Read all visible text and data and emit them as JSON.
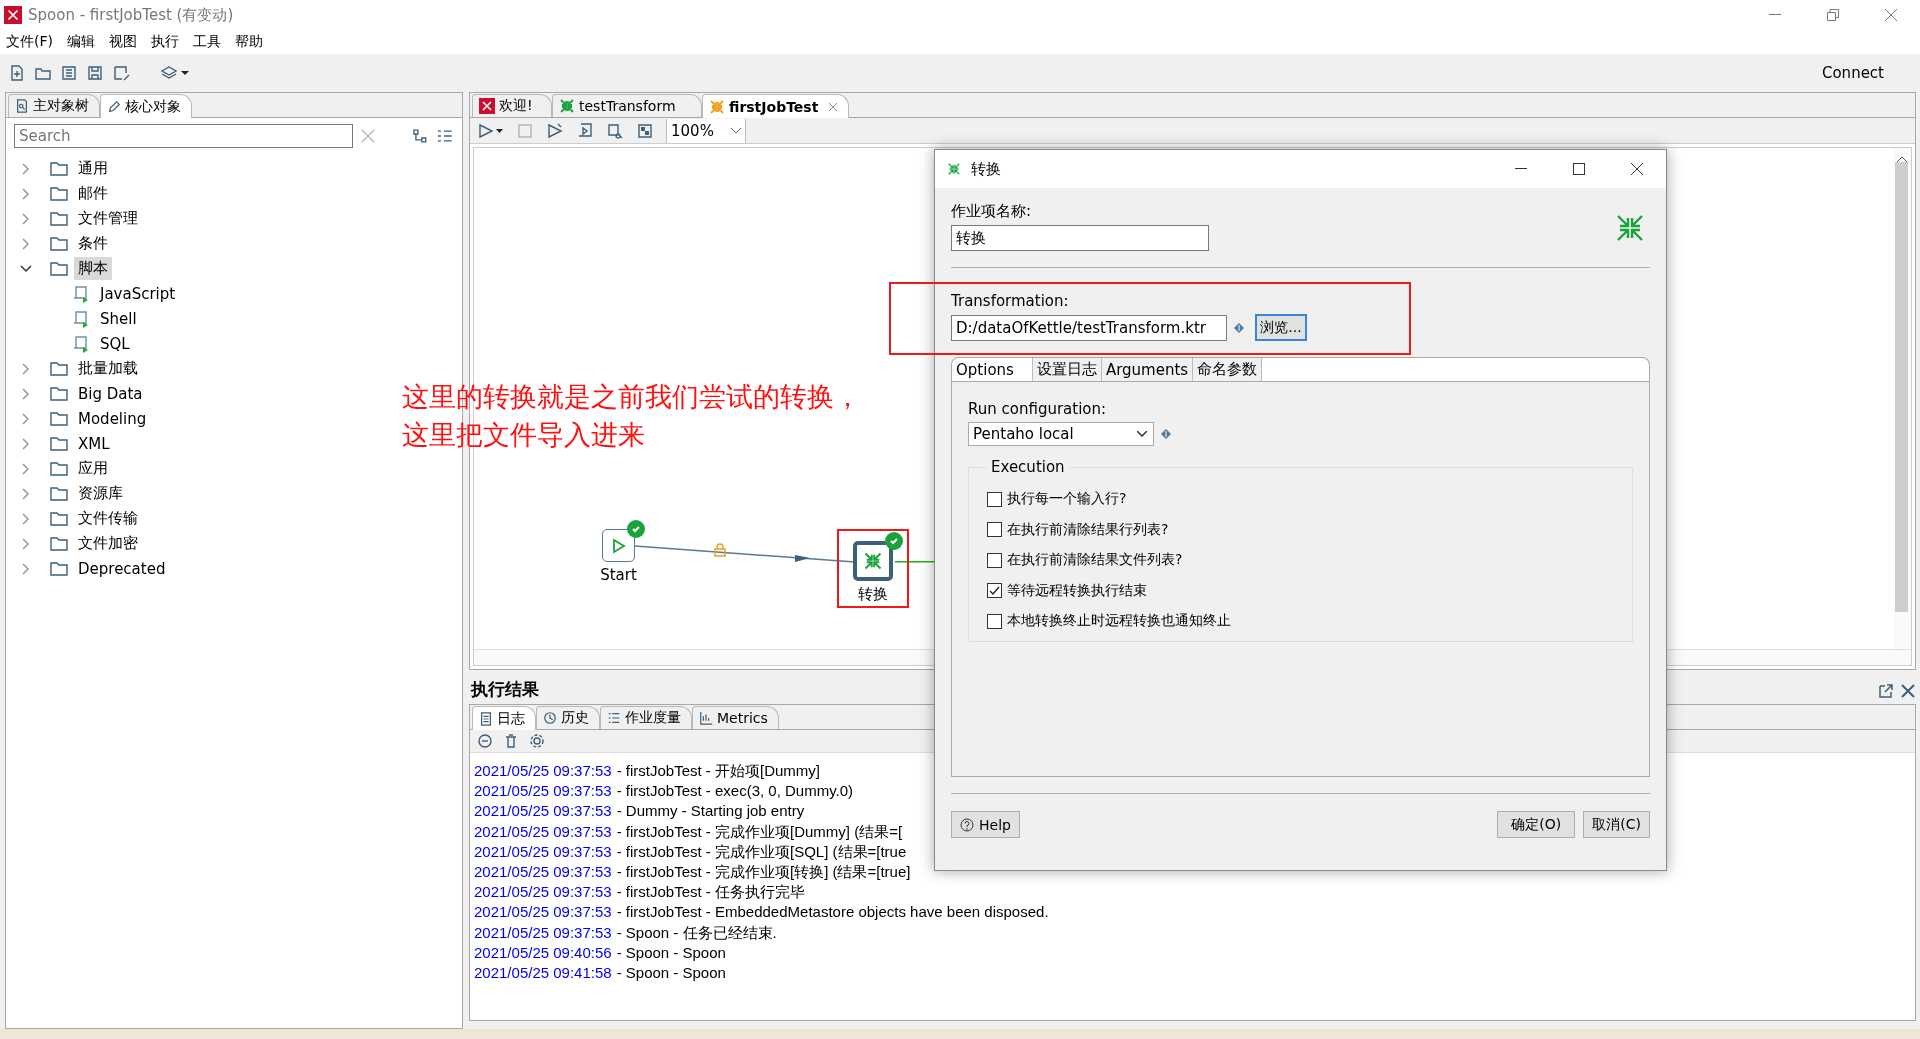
{
  "window": {
    "title": "Spoon - firstJobTest (有变动)"
  },
  "menu": [
    "文件(F)",
    "编辑",
    "视图",
    "执行",
    "工具",
    "帮助"
  ],
  "toolbar": {
    "connect": "Connect"
  },
  "left_panel": {
    "tabs": [
      {
        "label": "主对象树",
        "selected": false
      },
      {
        "label": "核心对象",
        "selected": true
      }
    ],
    "search": {
      "placeholder": "Search"
    },
    "tree": [
      {
        "label": "通用",
        "expanded": false,
        "selected": false
      },
      {
        "label": "邮件",
        "expanded": false,
        "selected": false
      },
      {
        "label": "文件管理",
        "expanded": false,
        "selected": false
      },
      {
        "label": "条件",
        "expanded": false,
        "selected": false
      },
      {
        "label": "脚本",
        "expanded": true,
        "selected": true,
        "children": [
          {
            "label": "JavaScript"
          },
          {
            "label": "Shell"
          },
          {
            "label": "SQL"
          }
        ]
      },
      {
        "label": "批量加载",
        "expanded": false,
        "selected": false
      },
      {
        "label": "Big Data",
        "expanded": false,
        "selected": false
      },
      {
        "label": "Modeling",
        "expanded": false,
        "selected": false
      },
      {
        "label": "XML",
        "expanded": false,
        "selected": false
      },
      {
        "label": "应用",
        "expanded": false,
        "selected": false
      },
      {
        "label": "资源库",
        "expanded": false,
        "selected": false
      },
      {
        "label": "文件传输",
        "expanded": false,
        "selected": false
      },
      {
        "label": "文件加密",
        "expanded": false,
        "selected": false
      },
      {
        "label": "Deprecated",
        "expanded": false,
        "selected": false
      }
    ]
  },
  "editor": {
    "tabs": [
      {
        "label": "欢迎!",
        "kind": "welcome",
        "selected": false
      },
      {
        "label": "testTransform",
        "kind": "transform",
        "selected": false
      },
      {
        "label": "firstJobTest",
        "kind": "job",
        "selected": true
      }
    ],
    "zoom": "100%",
    "annotation": [
      "这里的转换就是之前我们尝试的转换，",
      "这里把文件导入进来"
    ],
    "nodes": [
      {
        "label": "Start",
        "kind": "start",
        "done": true,
        "highlighted": false
      },
      {
        "label": "转换",
        "kind": "transform",
        "done": true,
        "highlighted": true
      }
    ]
  },
  "results": {
    "title": "执行结果",
    "tabs": [
      {
        "label": "日志",
        "selected": true
      },
      {
        "label": "历史",
        "selected": false
      },
      {
        "label": "作业度量",
        "selected": false
      },
      {
        "label": "Metrics",
        "selected": false
      }
    ],
    "log": [
      {
        "time": "2021/05/25 09:37:53",
        "message": "- firstJobTest - 开始项[Dummy]"
      },
      {
        "time": "2021/05/25 09:37:53",
        "message": "- firstJobTest - exec(3, 0, Dummy.0)"
      },
      {
        "time": "2021/05/25 09:37:53",
        "message": "- Dummy - Starting job entry"
      },
      {
        "time": "2021/05/25 09:37:53",
        "message": "- firstJobTest - 完成作业项[Dummy] (结果=["
      },
      {
        "time": "2021/05/25 09:37:53",
        "message": "- firstJobTest - 完成作业项[SQL] (结果=[true"
      },
      {
        "time": "2021/05/25 09:37:53",
        "message": "- firstJobTest - 完成作业项[转换] (结果=[true]"
      },
      {
        "time": "2021/05/25 09:37:53",
        "message": "- firstJobTest - 任务执行完毕"
      },
      {
        "time": "2021/05/25 09:37:53",
        "message": "- firstJobTest - EmbeddedMetastore objects have been disposed."
      },
      {
        "time": "2021/05/25 09:37:53",
        "message": "- Spoon - 任务已经结束."
      },
      {
        "time": "2021/05/25 09:40:56",
        "message": "- Spoon - Spoon"
      },
      {
        "time": "2021/05/25 09:41:58",
        "message": "- Spoon - Spoon"
      }
    ]
  },
  "dialog": {
    "title": "转换",
    "name_label": "作业项名称:",
    "name_value": "转换",
    "transformation_label": "Transformation:",
    "transformation_value": "D:/dataOfKettle/testTransform.ktr",
    "transformation_highlighted": true,
    "browse": "浏览...",
    "tabs": [
      {
        "label": "Options",
        "selected": true
      },
      {
        "label": "设置日志",
        "selected": false
      },
      {
        "label": "Arguments",
        "selected": false
      },
      {
        "label": "命名参数",
        "selected": false
      }
    ],
    "run_configuration_label": "Run configuration:",
    "run_configuration": "Pentaho local",
    "execution_title": "Execution",
    "options": [
      {
        "label": "执行每一个输入行?",
        "checked": false
      },
      {
        "label": "在执行前清除结果行列表?",
        "checked": false
      },
      {
        "label": "在执行前清除结果文件列表?",
        "checked": false
      },
      {
        "label": "等待远程转换执行结束",
        "checked": true
      },
      {
        "label": "本地转换终止时远程转换也通知终止",
        "checked": false
      }
    ],
    "buttons": {
      "help": "Help",
      "ok": "确定(O)",
      "cancel": "取消(C)"
    }
  }
}
